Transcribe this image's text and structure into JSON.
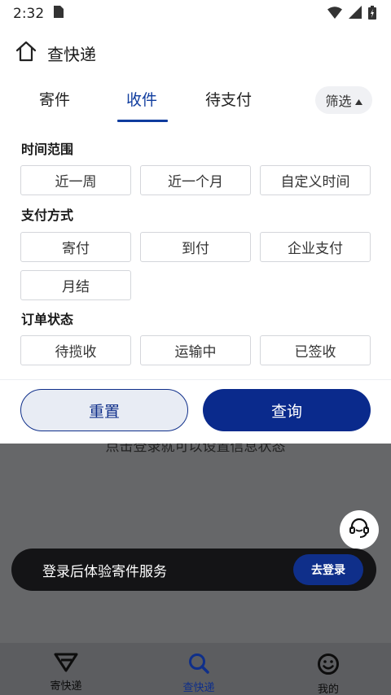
{
  "status_bar": {
    "time": "2:32"
  },
  "header": {
    "title": "查快递"
  },
  "tabs": [
    {
      "label": "寄件"
    },
    {
      "label": "收件"
    },
    {
      "label": "待支付"
    }
  ],
  "filter_toggle": {
    "label": "筛选"
  },
  "filters": {
    "time_range": {
      "title": "时间范围",
      "options": [
        "近一周",
        "近一个月",
        "自定义时间"
      ]
    },
    "payment": {
      "title": "支付方式",
      "options": [
        "寄付",
        "到付",
        "企业支付",
        "月结"
      ]
    },
    "order_status": {
      "title": "订单状态",
      "options": [
        "待揽收",
        "运输中",
        "已签收"
      ]
    }
  },
  "actions": {
    "reset": "重置",
    "query": "查询"
  },
  "overlay": {
    "partial_text": "点击登录就可以设置信息状态"
  },
  "login_banner": {
    "text": "登录后体验寄件服务",
    "button": "去登录"
  },
  "bottom_nav": [
    {
      "label": "寄快递",
      "icon": "send-icon"
    },
    {
      "label": "查快递",
      "icon": "search-icon"
    },
    {
      "label": "我的",
      "icon": "smile-icon"
    }
  ],
  "colors": {
    "primary": "#0a2a8c",
    "overlay": "#666769",
    "banner": "#141416"
  }
}
